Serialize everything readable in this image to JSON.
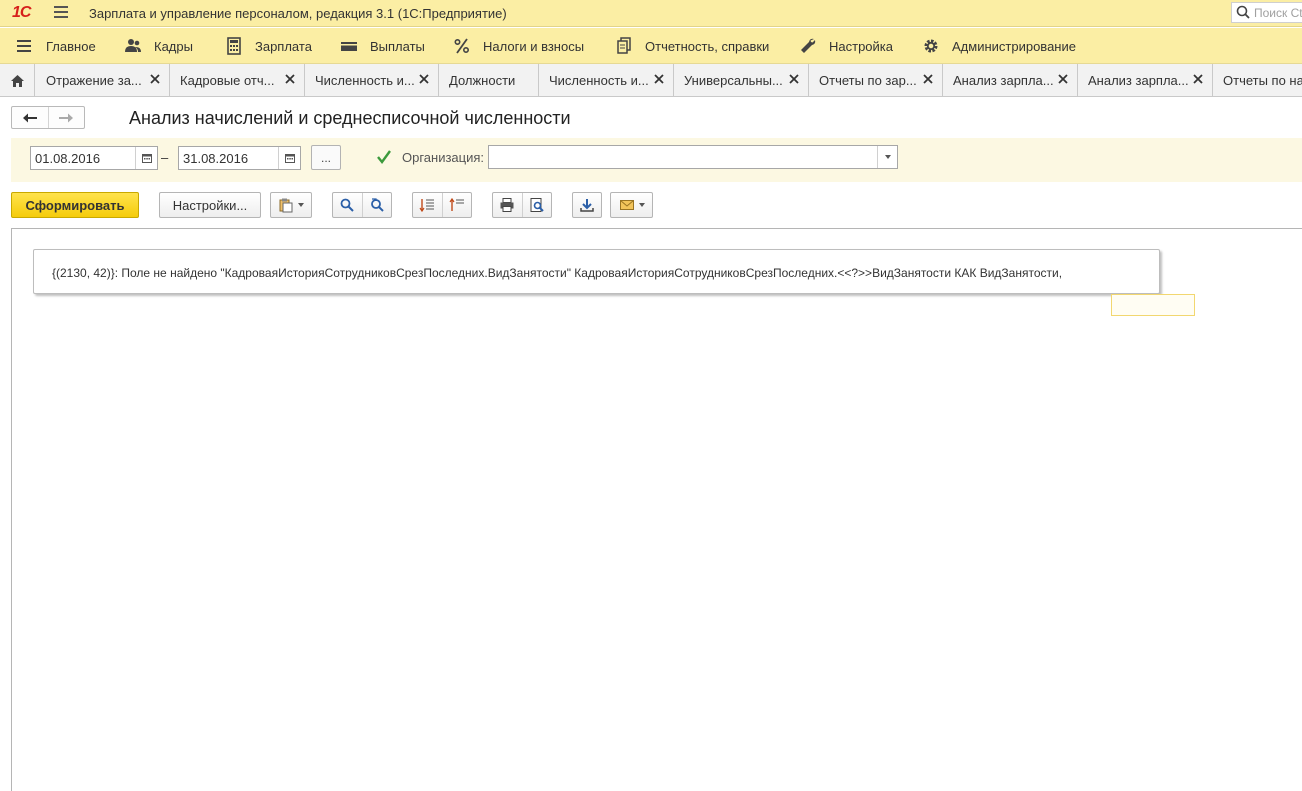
{
  "titlebar": {
    "logo": "1С",
    "title": "Зарплата и управление персоналом, редакция 3.1  (1С:Предприятие)",
    "search_placeholder": "Поиск Ctrl+Shift+F"
  },
  "menu": {
    "items": [
      {
        "label": "Главное",
        "icon": "list-icon"
      },
      {
        "label": "Кадры",
        "icon": "people-icon"
      },
      {
        "label": "Зарплата",
        "icon": "calculator-icon"
      },
      {
        "label": "Выплаты",
        "icon": "wallet-icon"
      },
      {
        "label": "Налоги и взносы",
        "icon": "percent-icon"
      },
      {
        "label": "Отчетность, справки",
        "icon": "documents-icon"
      },
      {
        "label": "Настройка",
        "icon": "wrench-icon"
      },
      {
        "label": "Администрирование",
        "icon": "gear-icon"
      }
    ]
  },
  "tabs": [
    {
      "label": "Отражение за..."
    },
    {
      "label": "Кадровые отч..."
    },
    {
      "label": "Численность и..."
    },
    {
      "label": "Должности"
    },
    {
      "label": "Численность и..."
    },
    {
      "label": "Универсальны..."
    },
    {
      "label": "Отчеты по зар..."
    },
    {
      "label": "Анализ зарпла..."
    },
    {
      "label": "Анализ зарпла..."
    },
    {
      "label": "Отчеты по на"
    }
  ],
  "form": {
    "title": "Анализ начислений и среднесписочной численности",
    "date_from": "01.08.2016",
    "date_to": "31.08.2016",
    "date_dash": "–",
    "period_button": "...",
    "org_checked": true,
    "org_label": "Организация:",
    "org_value": ""
  },
  "toolbar": {
    "generate_label": "Сформировать",
    "settings_label": "Настройки..."
  },
  "report": {
    "error_text": "{(2130, 42)}: Поле не найдено \"КадроваяИсторияСотрудниковСрезПоследних.ВидЗанятости\" КадроваяИсторияСотрудниковСрезПоследних.<<?>>ВидЗанятости КАК ВидЗанятости,"
  },
  "colors": {
    "accent_yellow": "#fbeea4",
    "generate_button": "#f5cc0b",
    "param_panel": "#fcf8e2",
    "logo_red": "#d6201b",
    "checkbox_green": "#3c9a3c"
  }
}
